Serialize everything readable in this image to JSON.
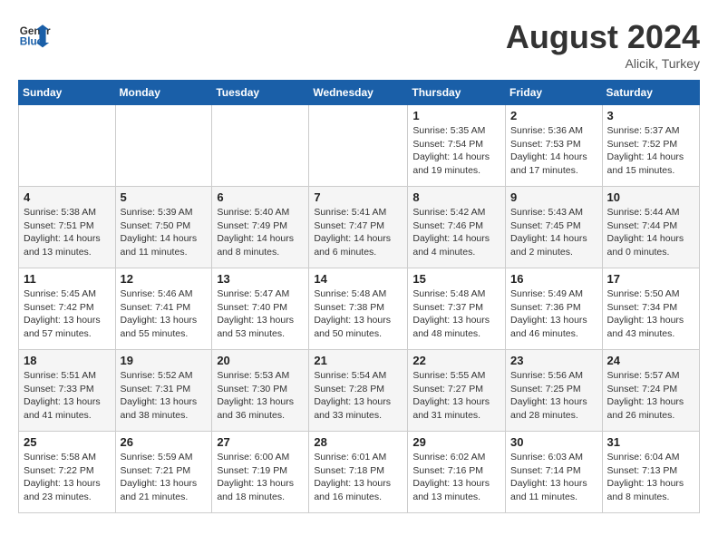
{
  "header": {
    "logo_line1": "General",
    "logo_line2": "Blue",
    "month": "August 2024",
    "location": "Alicik, Turkey"
  },
  "days_of_week": [
    "Sunday",
    "Monday",
    "Tuesday",
    "Wednesday",
    "Thursday",
    "Friday",
    "Saturday"
  ],
  "weeks": [
    [
      {
        "day": "",
        "info": ""
      },
      {
        "day": "",
        "info": ""
      },
      {
        "day": "",
        "info": ""
      },
      {
        "day": "",
        "info": ""
      },
      {
        "day": "1",
        "info": "Sunrise: 5:35 AM\nSunset: 7:54 PM\nDaylight: 14 hours\nand 19 minutes."
      },
      {
        "day": "2",
        "info": "Sunrise: 5:36 AM\nSunset: 7:53 PM\nDaylight: 14 hours\nand 17 minutes."
      },
      {
        "day": "3",
        "info": "Sunrise: 5:37 AM\nSunset: 7:52 PM\nDaylight: 14 hours\nand 15 minutes."
      }
    ],
    [
      {
        "day": "4",
        "info": "Sunrise: 5:38 AM\nSunset: 7:51 PM\nDaylight: 14 hours\nand 13 minutes."
      },
      {
        "day": "5",
        "info": "Sunrise: 5:39 AM\nSunset: 7:50 PM\nDaylight: 14 hours\nand 11 minutes."
      },
      {
        "day": "6",
        "info": "Sunrise: 5:40 AM\nSunset: 7:49 PM\nDaylight: 14 hours\nand 8 minutes."
      },
      {
        "day": "7",
        "info": "Sunrise: 5:41 AM\nSunset: 7:47 PM\nDaylight: 14 hours\nand 6 minutes."
      },
      {
        "day": "8",
        "info": "Sunrise: 5:42 AM\nSunset: 7:46 PM\nDaylight: 14 hours\nand 4 minutes."
      },
      {
        "day": "9",
        "info": "Sunrise: 5:43 AM\nSunset: 7:45 PM\nDaylight: 14 hours\nand 2 minutes."
      },
      {
        "day": "10",
        "info": "Sunrise: 5:44 AM\nSunset: 7:44 PM\nDaylight: 14 hours\nand 0 minutes."
      }
    ],
    [
      {
        "day": "11",
        "info": "Sunrise: 5:45 AM\nSunset: 7:42 PM\nDaylight: 13 hours\nand 57 minutes."
      },
      {
        "day": "12",
        "info": "Sunrise: 5:46 AM\nSunset: 7:41 PM\nDaylight: 13 hours\nand 55 minutes."
      },
      {
        "day": "13",
        "info": "Sunrise: 5:47 AM\nSunset: 7:40 PM\nDaylight: 13 hours\nand 53 minutes."
      },
      {
        "day": "14",
        "info": "Sunrise: 5:48 AM\nSunset: 7:38 PM\nDaylight: 13 hours\nand 50 minutes."
      },
      {
        "day": "15",
        "info": "Sunrise: 5:48 AM\nSunset: 7:37 PM\nDaylight: 13 hours\nand 48 minutes."
      },
      {
        "day": "16",
        "info": "Sunrise: 5:49 AM\nSunset: 7:36 PM\nDaylight: 13 hours\nand 46 minutes."
      },
      {
        "day": "17",
        "info": "Sunrise: 5:50 AM\nSunset: 7:34 PM\nDaylight: 13 hours\nand 43 minutes."
      }
    ],
    [
      {
        "day": "18",
        "info": "Sunrise: 5:51 AM\nSunset: 7:33 PM\nDaylight: 13 hours\nand 41 minutes."
      },
      {
        "day": "19",
        "info": "Sunrise: 5:52 AM\nSunset: 7:31 PM\nDaylight: 13 hours\nand 38 minutes."
      },
      {
        "day": "20",
        "info": "Sunrise: 5:53 AM\nSunset: 7:30 PM\nDaylight: 13 hours\nand 36 minutes."
      },
      {
        "day": "21",
        "info": "Sunrise: 5:54 AM\nSunset: 7:28 PM\nDaylight: 13 hours\nand 33 minutes."
      },
      {
        "day": "22",
        "info": "Sunrise: 5:55 AM\nSunset: 7:27 PM\nDaylight: 13 hours\nand 31 minutes."
      },
      {
        "day": "23",
        "info": "Sunrise: 5:56 AM\nSunset: 7:25 PM\nDaylight: 13 hours\nand 28 minutes."
      },
      {
        "day": "24",
        "info": "Sunrise: 5:57 AM\nSunset: 7:24 PM\nDaylight: 13 hours\nand 26 minutes."
      }
    ],
    [
      {
        "day": "25",
        "info": "Sunrise: 5:58 AM\nSunset: 7:22 PM\nDaylight: 13 hours\nand 23 minutes."
      },
      {
        "day": "26",
        "info": "Sunrise: 5:59 AM\nSunset: 7:21 PM\nDaylight: 13 hours\nand 21 minutes."
      },
      {
        "day": "27",
        "info": "Sunrise: 6:00 AM\nSunset: 7:19 PM\nDaylight: 13 hours\nand 18 minutes."
      },
      {
        "day": "28",
        "info": "Sunrise: 6:01 AM\nSunset: 7:18 PM\nDaylight: 13 hours\nand 16 minutes."
      },
      {
        "day": "29",
        "info": "Sunrise: 6:02 AM\nSunset: 7:16 PM\nDaylight: 13 hours\nand 13 minutes."
      },
      {
        "day": "30",
        "info": "Sunrise: 6:03 AM\nSunset: 7:14 PM\nDaylight: 13 hours\nand 11 minutes."
      },
      {
        "day": "31",
        "info": "Sunrise: 6:04 AM\nSunset: 7:13 PM\nDaylight: 13 hours\nand 8 minutes."
      }
    ]
  ]
}
